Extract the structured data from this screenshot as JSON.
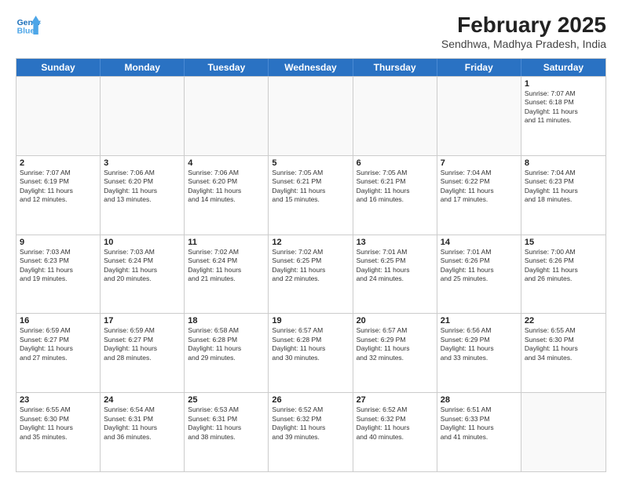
{
  "header": {
    "logo_line1": "General",
    "logo_line2": "Blue",
    "title": "February 2025",
    "subtitle": "Sendhwa, Madhya Pradesh, India"
  },
  "days": [
    "Sunday",
    "Monday",
    "Tuesday",
    "Wednesday",
    "Thursday",
    "Friday",
    "Saturday"
  ],
  "weeks": [
    [
      {
        "day": "",
        "info": ""
      },
      {
        "day": "",
        "info": ""
      },
      {
        "day": "",
        "info": ""
      },
      {
        "day": "",
        "info": ""
      },
      {
        "day": "",
        "info": ""
      },
      {
        "day": "",
        "info": ""
      },
      {
        "day": "1",
        "info": "Sunrise: 7:07 AM\nSunset: 6:18 PM\nDaylight: 11 hours\nand 11 minutes."
      }
    ],
    [
      {
        "day": "2",
        "info": "Sunrise: 7:07 AM\nSunset: 6:19 PM\nDaylight: 11 hours\nand 12 minutes."
      },
      {
        "day": "3",
        "info": "Sunrise: 7:06 AM\nSunset: 6:20 PM\nDaylight: 11 hours\nand 13 minutes."
      },
      {
        "day": "4",
        "info": "Sunrise: 7:06 AM\nSunset: 6:20 PM\nDaylight: 11 hours\nand 14 minutes."
      },
      {
        "day": "5",
        "info": "Sunrise: 7:05 AM\nSunset: 6:21 PM\nDaylight: 11 hours\nand 15 minutes."
      },
      {
        "day": "6",
        "info": "Sunrise: 7:05 AM\nSunset: 6:21 PM\nDaylight: 11 hours\nand 16 minutes."
      },
      {
        "day": "7",
        "info": "Sunrise: 7:04 AM\nSunset: 6:22 PM\nDaylight: 11 hours\nand 17 minutes."
      },
      {
        "day": "8",
        "info": "Sunrise: 7:04 AM\nSunset: 6:23 PM\nDaylight: 11 hours\nand 18 minutes."
      }
    ],
    [
      {
        "day": "9",
        "info": "Sunrise: 7:03 AM\nSunset: 6:23 PM\nDaylight: 11 hours\nand 19 minutes."
      },
      {
        "day": "10",
        "info": "Sunrise: 7:03 AM\nSunset: 6:24 PM\nDaylight: 11 hours\nand 20 minutes."
      },
      {
        "day": "11",
        "info": "Sunrise: 7:02 AM\nSunset: 6:24 PM\nDaylight: 11 hours\nand 21 minutes."
      },
      {
        "day": "12",
        "info": "Sunrise: 7:02 AM\nSunset: 6:25 PM\nDaylight: 11 hours\nand 22 minutes."
      },
      {
        "day": "13",
        "info": "Sunrise: 7:01 AM\nSunset: 6:25 PM\nDaylight: 11 hours\nand 24 minutes."
      },
      {
        "day": "14",
        "info": "Sunrise: 7:01 AM\nSunset: 6:26 PM\nDaylight: 11 hours\nand 25 minutes."
      },
      {
        "day": "15",
        "info": "Sunrise: 7:00 AM\nSunset: 6:26 PM\nDaylight: 11 hours\nand 26 minutes."
      }
    ],
    [
      {
        "day": "16",
        "info": "Sunrise: 6:59 AM\nSunset: 6:27 PM\nDaylight: 11 hours\nand 27 minutes."
      },
      {
        "day": "17",
        "info": "Sunrise: 6:59 AM\nSunset: 6:27 PM\nDaylight: 11 hours\nand 28 minutes."
      },
      {
        "day": "18",
        "info": "Sunrise: 6:58 AM\nSunset: 6:28 PM\nDaylight: 11 hours\nand 29 minutes."
      },
      {
        "day": "19",
        "info": "Sunrise: 6:57 AM\nSunset: 6:28 PM\nDaylight: 11 hours\nand 30 minutes."
      },
      {
        "day": "20",
        "info": "Sunrise: 6:57 AM\nSunset: 6:29 PM\nDaylight: 11 hours\nand 32 minutes."
      },
      {
        "day": "21",
        "info": "Sunrise: 6:56 AM\nSunset: 6:29 PM\nDaylight: 11 hours\nand 33 minutes."
      },
      {
        "day": "22",
        "info": "Sunrise: 6:55 AM\nSunset: 6:30 PM\nDaylight: 11 hours\nand 34 minutes."
      }
    ],
    [
      {
        "day": "23",
        "info": "Sunrise: 6:55 AM\nSunset: 6:30 PM\nDaylight: 11 hours\nand 35 minutes."
      },
      {
        "day": "24",
        "info": "Sunrise: 6:54 AM\nSunset: 6:31 PM\nDaylight: 11 hours\nand 36 minutes."
      },
      {
        "day": "25",
        "info": "Sunrise: 6:53 AM\nSunset: 6:31 PM\nDaylight: 11 hours\nand 38 minutes."
      },
      {
        "day": "26",
        "info": "Sunrise: 6:52 AM\nSunset: 6:32 PM\nDaylight: 11 hours\nand 39 minutes."
      },
      {
        "day": "27",
        "info": "Sunrise: 6:52 AM\nSunset: 6:32 PM\nDaylight: 11 hours\nand 40 minutes."
      },
      {
        "day": "28",
        "info": "Sunrise: 6:51 AM\nSunset: 6:33 PM\nDaylight: 11 hours\nand 41 minutes."
      },
      {
        "day": "",
        "info": ""
      }
    ]
  ]
}
